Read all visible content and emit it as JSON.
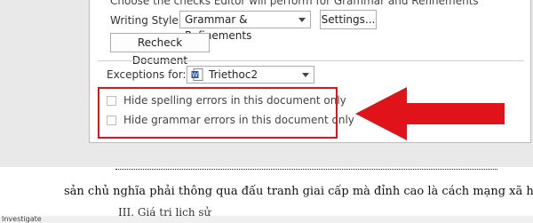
{
  "dialog": {
    "cut_caption": "Choose the checks Editor will perform for Grammar and Refinements",
    "writing_style_label": "Writing Style:",
    "writing_style_value": "Grammar & Refinements",
    "settings_label": "Settings...",
    "recheck_label": "Recheck Document",
    "exceptions_label": "Exceptions for:",
    "document_name": "Triethoc2",
    "hide_spelling_label": "Hide spelling errors in this document only",
    "hide_grammar_label": "Hide grammar errors in this document only"
  },
  "document": {
    "line1": "sản chủ nghĩa phải thông qua đấu tranh giai cấp mà đỉnh cao là cách mạng xã hội.",
    "line2": "III. Giá trị lịch sử"
  },
  "status": {
    "text": "Investigate"
  },
  "colors": {
    "highlight": "#e0131a",
    "word_icon": "#2b579a"
  }
}
